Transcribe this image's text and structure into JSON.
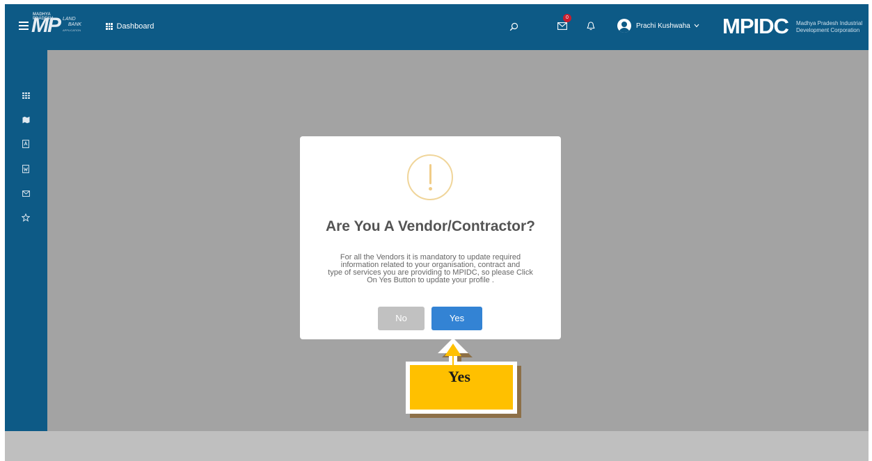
{
  "header": {
    "app_logo": "MP",
    "app_logo_small": "MADHYA PRADESH",
    "app_sub_line1": "LAND",
    "app_sub_line2": "BANK",
    "app_sub_line3": "APPLICATION",
    "dashboard_label": "Dashboard",
    "mail_badge": "0",
    "user_name": "Prachi Kushwaha",
    "org_logo": "MPIDC",
    "org_name_line1": "Madhya Pradesh Industrial",
    "org_name_line2": "Development Corporation"
  },
  "sidebar": {
    "items": [
      {
        "icon": "grid-icon"
      },
      {
        "icon": "map-icon"
      },
      {
        "icon": "pdf-icon"
      },
      {
        "icon": "word-icon"
      },
      {
        "icon": "mail-icon"
      },
      {
        "icon": "star-icon"
      }
    ]
  },
  "modal": {
    "icon": "warning-icon",
    "title": "Are You A Vendor/Contractor?",
    "message_lines": [
      "For all the Vendors it is mandatory to update required",
      "information related to your organisation, contract and",
      "type of services you are providing to MPIDC, so please Click",
      "On Yes Button to update your profile ."
    ],
    "no_label": "No",
    "yes_label": "Yes"
  },
  "callout": {
    "label": "Yes",
    "color": "#ffc000"
  },
  "colors": {
    "header": "#0d5a86",
    "overlay": "#a3a3a3",
    "yes_button": "#3383d4",
    "no_button": "#c1c1c1",
    "warning": "#f0cc88"
  }
}
